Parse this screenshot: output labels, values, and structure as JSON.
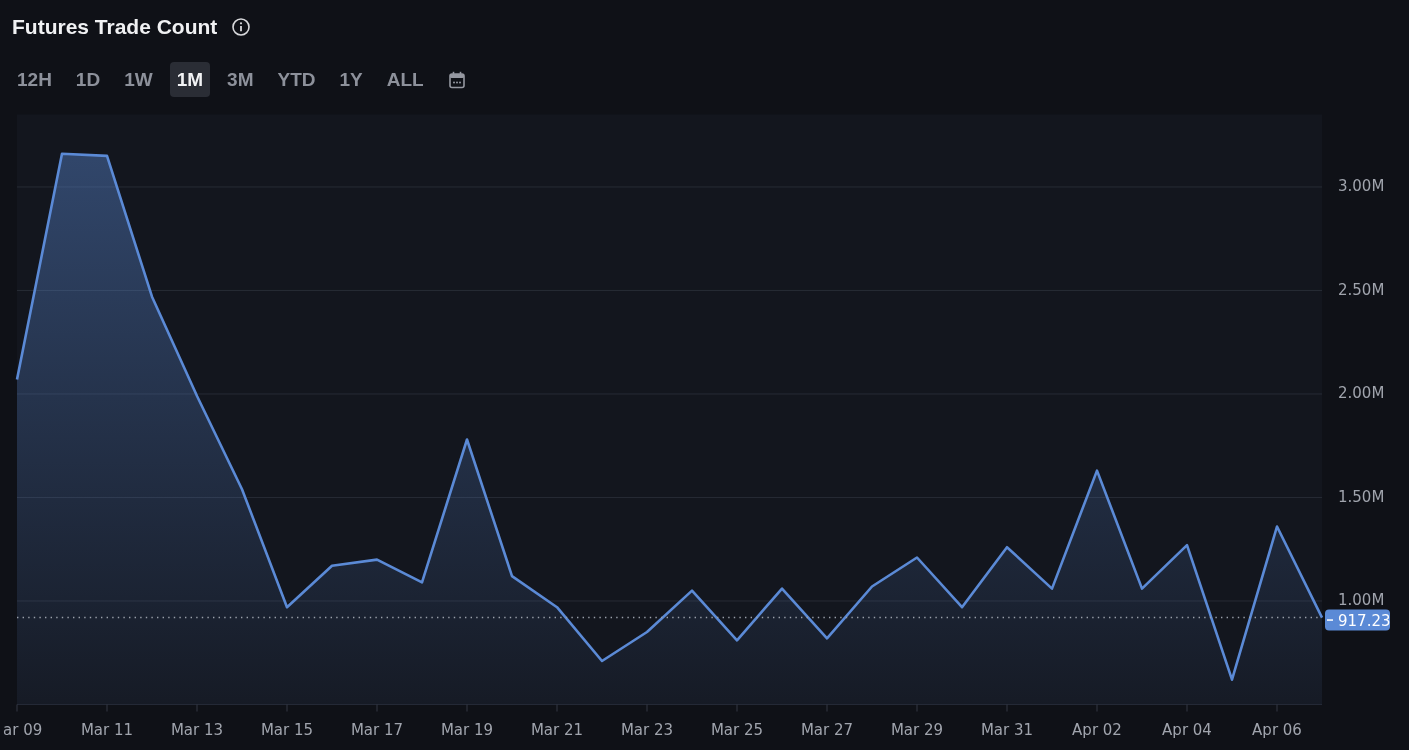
{
  "header": {
    "title": "Futures Trade Count"
  },
  "ranges": [
    {
      "label": "12H",
      "selected": false
    },
    {
      "label": "1D",
      "selected": false
    },
    {
      "label": "1W",
      "selected": false
    },
    {
      "label": "1M",
      "selected": true
    },
    {
      "label": "3M",
      "selected": false
    },
    {
      "label": "YTD",
      "selected": false
    },
    {
      "label": "1Y",
      "selected": false
    },
    {
      "label": "ALL",
      "selected": false
    }
  ],
  "chart": {
    "chart_data": {
      "type": "area",
      "categories": [
        "ar 09",
        null,
        "Mar 11",
        null,
        "Mar 13",
        null,
        "Mar 15",
        null,
        "Mar 17",
        null,
        "Mar 19",
        null,
        "Mar 21",
        null,
        "Mar 23",
        null,
        "Mar 25",
        null,
        "Mar 27",
        null,
        "Mar 29",
        null,
        "Mar 31",
        null,
        "Apr 02",
        null,
        "Apr 04",
        null,
        "Apr 06",
        null
      ],
      "series": [
        {
          "color": "#5b8ad6",
          "values": [
            2.07,
            3.16,
            3.15,
            2.47,
            1.99,
            1.54,
            0.97,
            1.17,
            1.2,
            1.09,
            1.78,
            1.12,
            0.97,
            0.71,
            0.85,
            1.05,
            0.81,
            1.06,
            0.82,
            1.07,
            1.21,
            0.97,
            1.26,
            1.06,
            1.63,
            1.06,
            1.27,
            0.62,
            1.36,
            0.92
          ]
        }
      ],
      "ylim": [
        0.5,
        3.35
      ],
      "yticks": [
        {
          "value": 1,
          "label": "1.00M"
        },
        {
          "value": 1.5,
          "label": "1.50M"
        },
        {
          "value": 2,
          "label": "2.00M"
        },
        {
          "value": 2.5,
          "label": "2.50M"
        },
        {
          "value": 3,
          "label": "3.00M"
        }
      ],
      "grid": true,
      "ref_lines": [
        {
          "axis": "y",
          "value": 0.92
        }
      ]
    },
    "last_value_tag": "917.23"
  }
}
